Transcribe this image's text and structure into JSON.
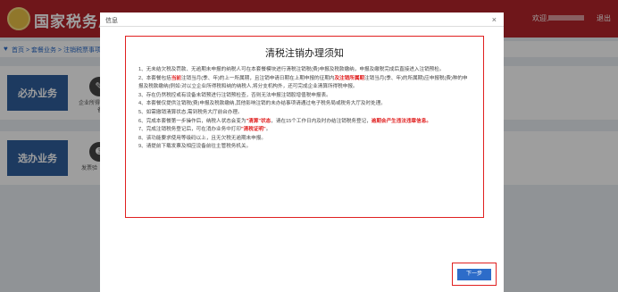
{
  "header": {
    "brand": "国家税务总局安",
    "greeting": "欢迎,",
    "logout": "退出"
  },
  "breadcrumb": {
    "pin": "♥",
    "text": "首页  >  套餐业务  >  注销税票事项办理套餐"
  },
  "panels": [
    {
      "label": "必办业务",
      "icon": "✎",
      "service": "企业所得税清算报备"
    },
    {
      "label": "选办业务",
      "icon": "❸",
      "service": "发票验（交）旧"
    }
  ],
  "dialog": {
    "title": "信息",
    "close": "×",
    "notice_title": "清税注销办理须知",
    "lines": [
      {
        "pre": "1、无未结欠税及罚款、无逾期未申报的纳税人可在本套餐模块进行清税注销税(费)申报及税款缴纳，申报及缴税完成后直接进入注销预检。"
      },
      {
        "pre": "2、本套餐包括",
        "h1": "当前",
        "mid": "注销当月(季、年)的上一所属期，且注销申请日期在上期申报的征期内",
        "h2": "及注销所属期",
        "post": "注销当月(季、年)的所属期)应申报税(费)种的申报及税款缴纳(例如:对以立企业所得税和纳的纳税人,将分支机构外，还可完成企业清算所得税申报。",
        "wrap": true
      },
      {
        "pre": "3、存在仍然税控或有设备未销预进行注销预检查，否则无法申报注销股增值税申报表。"
      },
      {
        "pre": "4、本套餐仅提供注销税(费)申报及税款缴纳,其他影响注销的未办结事项请通过电子税务局或税务大厅及时处理。"
      },
      {
        "pre": "5、如需撤销清算状态,需到税务大厅前台办理。"
      },
      {
        "pre": "6、完成本套餐第一步操作后，纳税人状态会变为",
        "h1": "\"清算\"状态",
        "mid": "，请在15个工作日内及时办结注销税务登记，",
        "h2": "逾期会产生违法违章信息。"
      },
      {
        "pre": "7、完成注销税务登记后，可在消办业务中打印",
        "h1": "\"清税证明\"",
        "mid": "。"
      },
      {
        "pre": "8、该功能要求使用等级码以上，且无欠税无逾期未申报。"
      },
      {
        "pre": "9、请提前下载发票及相应设备前往主管税务机关。"
      }
    ],
    "next_button": "下一步"
  },
  "colors": {
    "header_red": "#b3252a",
    "accent_blue": "#2d6cc9",
    "highlight_red": "#e02020",
    "label_blue": "#2f5e9b"
  }
}
